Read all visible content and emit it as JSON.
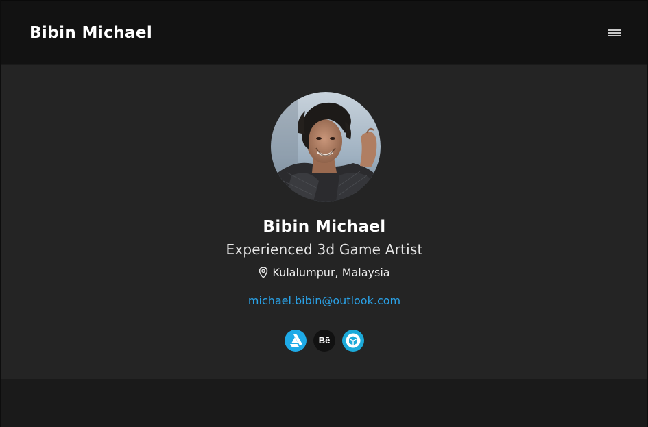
{
  "header": {
    "brand": "Bibin Michael",
    "menu_icon": "hamburger-menu-icon"
  },
  "profile": {
    "name": "Bibin Michael",
    "title": "Experienced 3d Game Artist",
    "location": "Kulalumpur, Malaysia",
    "location_icon": "map-pin-icon",
    "email": "michael.bibin@outlook.com",
    "avatar_icon": "profile-photo"
  },
  "socials": [
    {
      "icon": "artstation-icon",
      "color": "#1eaae7"
    },
    {
      "icon": "behance-icon",
      "label": "Bē",
      "color": "#111111"
    },
    {
      "icon": "sketchfab-icon",
      "color": "#1caad9"
    }
  ],
  "colors": {
    "header_bg": "#121212",
    "hero_bg": "#242424",
    "page_bg": "#1a1a1a",
    "accent": "#2aa1e6"
  }
}
